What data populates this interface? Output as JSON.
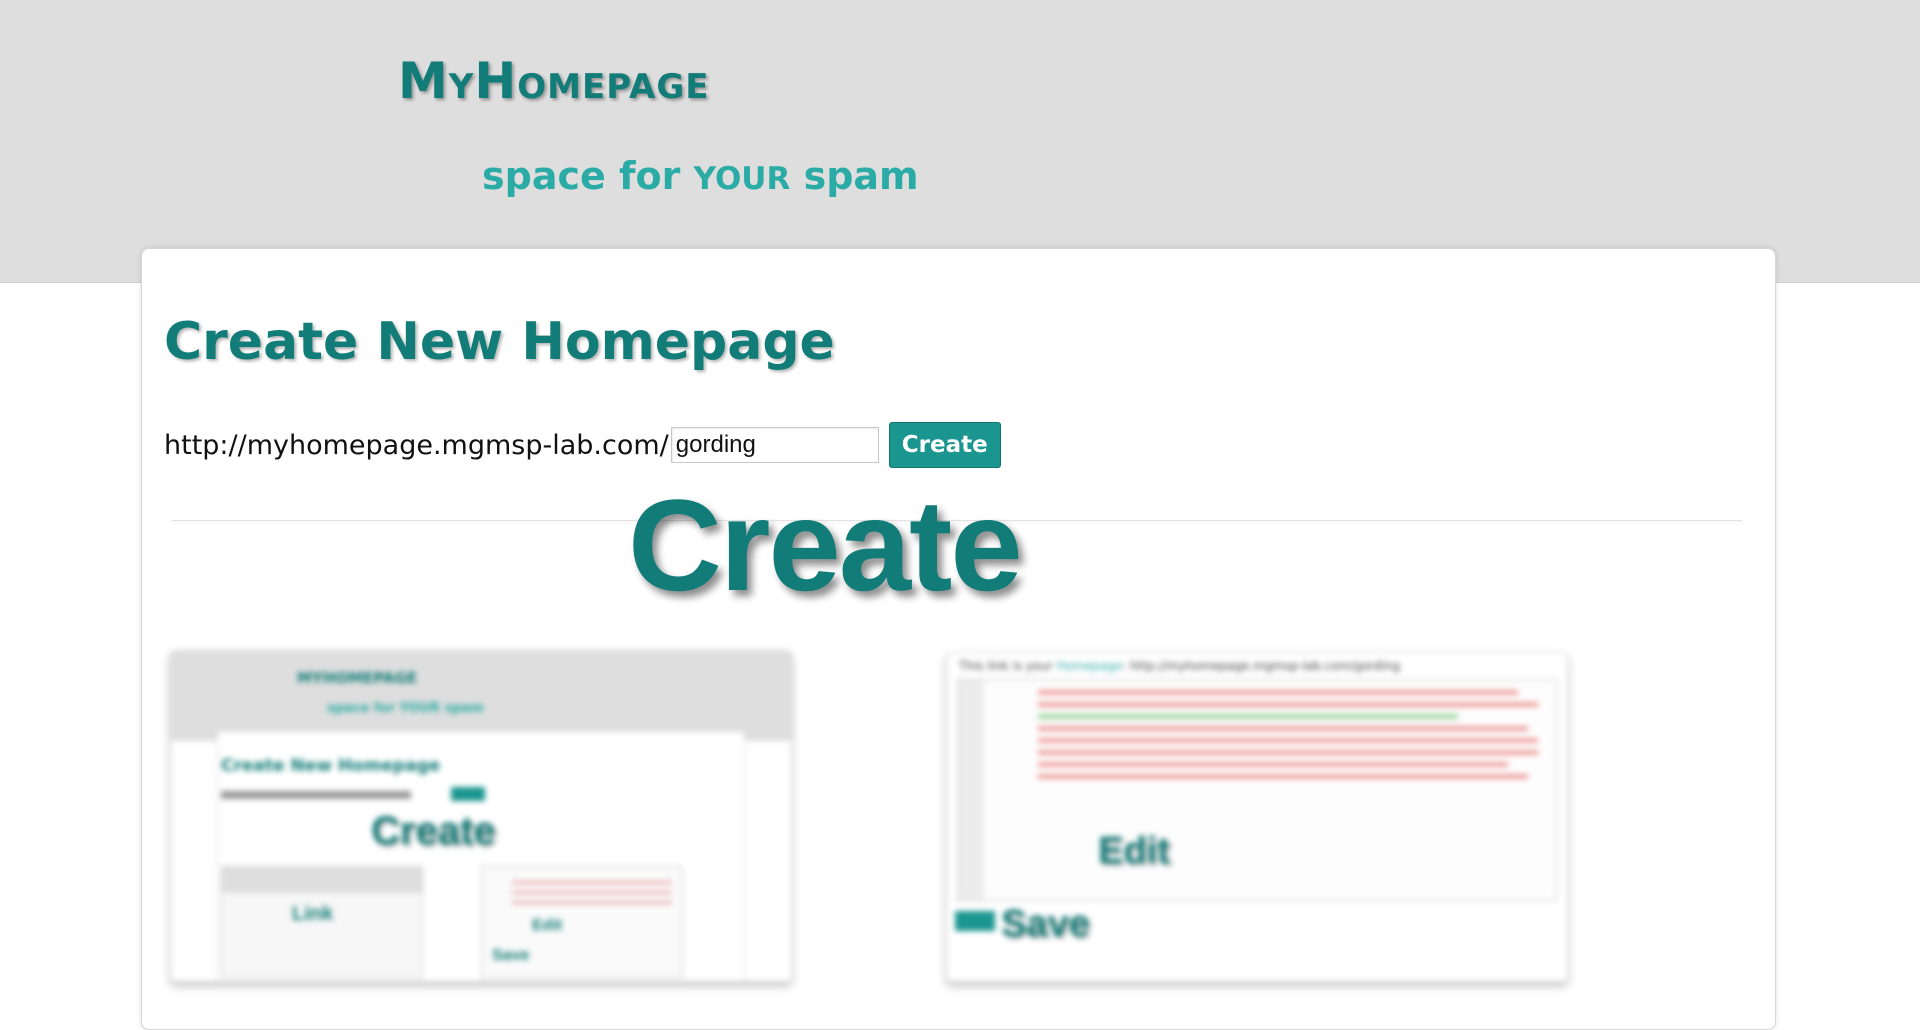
{
  "header": {
    "site_title_first": "M",
    "site_title_rest_a": "Y",
    "site_title_h": "H",
    "site_title_rest_b": "OMEPAGE",
    "tagline_a": "space for ",
    "tagline_caps": "YOUR",
    "tagline_b": " spam"
  },
  "main": {
    "heading": "Create New Homepage",
    "url_prefix": "http://myhomepage.mgmsp-lab.com/",
    "name_input_value": "gording",
    "create_button": "Create",
    "overlay_label": "Create"
  },
  "preview": {
    "left_thumb": {
      "title": "MYHOMEPAGE",
      "tagline": "space for YOUR spam",
      "heading": "Create New Homepage",
      "overlay": "Create",
      "sub1_label": "Link",
      "sub2_label": "Edit",
      "sub2_label2": "Save"
    },
    "right_thumb": {
      "top_text_a": "This link is your ",
      "top_link": "Homepage",
      "top_text_b": ": http://myhomepage.mgmsp-lab.com/gording",
      "edit_label": "Edit",
      "save_label": "Save"
    }
  },
  "colors": {
    "accent": "#127c78",
    "accent_light": "#2aaba5",
    "button": "#1b958f",
    "header_bg": "#dedede"
  }
}
